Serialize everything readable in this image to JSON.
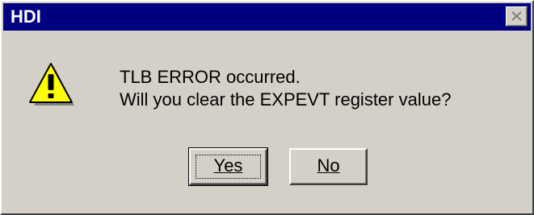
{
  "window": {
    "title": "HDI",
    "close_icon": "close-icon"
  },
  "dialog": {
    "icon": "warning-icon",
    "icon_colors": {
      "fill": "#ffff00",
      "outline": "#000000",
      "shadow": "#808080"
    },
    "message_line1": "TLB ERROR occurred.",
    "message_line2": "Will you clear the EXPEVT register value?"
  },
  "buttons": {
    "yes_label": "Yes",
    "no_label": "No",
    "default": "Yes"
  },
  "colors": {
    "titlebar": "#000080",
    "face": "#d4d0c8"
  }
}
